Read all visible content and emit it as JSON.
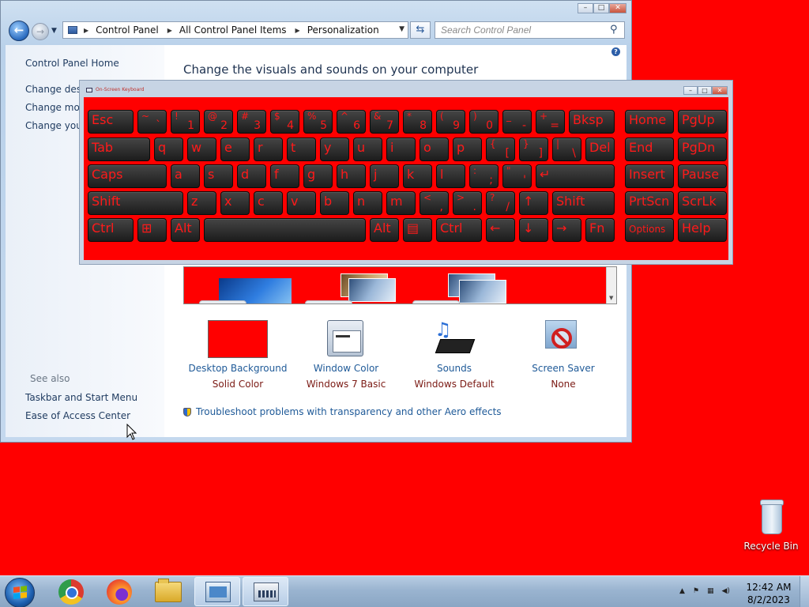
{
  "control_panel": {
    "breadcrumb": [
      "Control Panel",
      "All Control Panel Items",
      "Personalization"
    ],
    "search_placeholder": "Search Control Panel",
    "sidebar": {
      "home": "Control Panel Home",
      "links": [
        "Change desk",
        "Change mou",
        "Change your"
      ],
      "see_also_label": "See also",
      "see_also": [
        "Taskbar and Start Menu",
        "Ease of Access Center"
      ]
    },
    "main_title": "Change the visuals and sounds on your computer",
    "options": [
      {
        "label": "Desktop Background",
        "value": "Solid Color",
        "icon": "desktop-background-swatch-icon"
      },
      {
        "label": "Window Color",
        "value": "Windows 7 Basic",
        "icon": "window-color-icon"
      },
      {
        "label": "Sounds",
        "value": "Windows Default",
        "icon": "sounds-icon"
      },
      {
        "label": "Screen Saver",
        "value": "None",
        "icon": "screen-saver-icon"
      }
    ],
    "troubleshoot_link": "Troubleshoot problems with transparency and other Aero effects",
    "swatch_color": "#ff0000"
  },
  "osk": {
    "title": "On-Screen Keyboard",
    "rows": [
      [
        {
          "m": "Esc",
          "w": 58
        },
        {
          "s": "~",
          "b": "`",
          "w": 37
        },
        {
          "s": "!",
          "b": "1",
          "w": 37
        },
        {
          "s": "@",
          "b": "2",
          "w": 37
        },
        {
          "s": "#",
          "b": "3",
          "w": 37
        },
        {
          "s": "$",
          "b": "4",
          "w": 37
        },
        {
          "s": "%",
          "b": "5",
          "w": 37
        },
        {
          "s": "^",
          "b": "6",
          "w": 37
        },
        {
          "s": "&",
          "b": "7",
          "w": 37
        },
        {
          "s": "*",
          "b": "8",
          "w": 37
        },
        {
          "s": "(",
          "b": "9",
          "w": 37
        },
        {
          "s": ")",
          "b": "0",
          "w": 37
        },
        {
          "s": "_",
          "b": "-",
          "w": 37
        },
        {
          "s": "+",
          "b": "=",
          "w": 37
        },
        {
          "m": "Bksp",
          "w": 58
        },
        {
          "m": "Home",
          "w": 62,
          "gap": 8
        },
        {
          "m": "PgUp",
          "w": 62
        }
      ],
      [
        {
          "m": "Tab",
          "w": 79
        },
        {
          "m": "q",
          "w": 37
        },
        {
          "m": "w",
          "w": 37
        },
        {
          "m": "e",
          "w": 37
        },
        {
          "m": "r",
          "w": 37
        },
        {
          "m": "t",
          "w": 37
        },
        {
          "m": "y",
          "w": 37
        },
        {
          "m": "u",
          "w": 37
        },
        {
          "m": "i",
          "w": 37
        },
        {
          "m": "o",
          "w": 37
        },
        {
          "m": "p",
          "w": 37
        },
        {
          "s": "{",
          "b": "[",
          "w": 37
        },
        {
          "s": "}",
          "b": "]",
          "w": 37
        },
        {
          "s": "|",
          "b": "\\",
          "w": 37
        },
        {
          "m": "Del",
          "w": 37
        },
        {
          "m": "End",
          "w": 62,
          "gap": 8
        },
        {
          "m": "PgDn",
          "w": 62
        }
      ],
      [
        {
          "m": "Caps",
          "w": 100
        },
        {
          "m": "a",
          "w": 37
        },
        {
          "m": "s",
          "w": 37
        },
        {
          "m": "d",
          "w": 37
        },
        {
          "m": "f",
          "w": 37
        },
        {
          "m": "g",
          "w": 37
        },
        {
          "m": "h",
          "w": 37
        },
        {
          "m": "j",
          "w": 37
        },
        {
          "m": "k",
          "w": 37
        },
        {
          "m": "l",
          "w": 37
        },
        {
          "s": ":",
          "b": ";",
          "w": 37
        },
        {
          "s": "\"",
          "b": "'",
          "w": 37
        },
        {
          "m": "↵",
          "w": 100
        },
        {
          "m": "Insert",
          "w": 62,
          "gap": 8
        },
        {
          "m": "Pause",
          "w": 62
        }
      ],
      [
        {
          "m": "Shift",
          "w": 121
        },
        {
          "m": "z",
          "w": 37
        },
        {
          "m": "x",
          "w": 37
        },
        {
          "m": "c",
          "w": 37
        },
        {
          "m": "v",
          "w": 37
        },
        {
          "m": "b",
          "w": 37
        },
        {
          "m": "n",
          "w": 37
        },
        {
          "m": "m",
          "w": 37
        },
        {
          "s": "<",
          "b": ",",
          "w": 37
        },
        {
          "s": ">",
          "b": ".",
          "w": 37
        },
        {
          "s": "?",
          "b": "/",
          "w": 37
        },
        {
          "m": "↑",
          "w": 37
        },
        {
          "m": "Shift",
          "w": 79
        },
        {
          "m": "PrtScn",
          "w": 62,
          "gap": 8
        },
        {
          "m": "ScrLk",
          "w": 62
        }
      ],
      [
        {
          "m": "Ctrl",
          "w": 58
        },
        {
          "m": "⊞",
          "w": 37
        },
        {
          "m": "Alt",
          "w": 37
        },
        {
          "m": "",
          "w": 205
        },
        {
          "m": "Alt",
          "w": 37
        },
        {
          "m": "▤",
          "w": 37
        },
        {
          "m": "Ctrl",
          "w": 58
        },
        {
          "m": "←",
          "w": 37
        },
        {
          "m": "↓",
          "w": 37
        },
        {
          "m": "→",
          "w": 37
        },
        {
          "m": "Fn",
          "w": 37
        },
        {
          "m": "Options",
          "w": 62,
          "gap": 8,
          "small": true
        },
        {
          "m": "Help",
          "w": 62
        }
      ]
    ]
  },
  "desktop": {
    "recycle_bin": "Recycle Bin"
  },
  "taskbar": {
    "items": [
      "chrome-icon",
      "firefox-icon",
      "explorer-folder-icon",
      "control-panel-icon",
      "on-screen-keyboard-icon"
    ],
    "time": "12:42 AM",
    "date": "8/2/2023"
  }
}
